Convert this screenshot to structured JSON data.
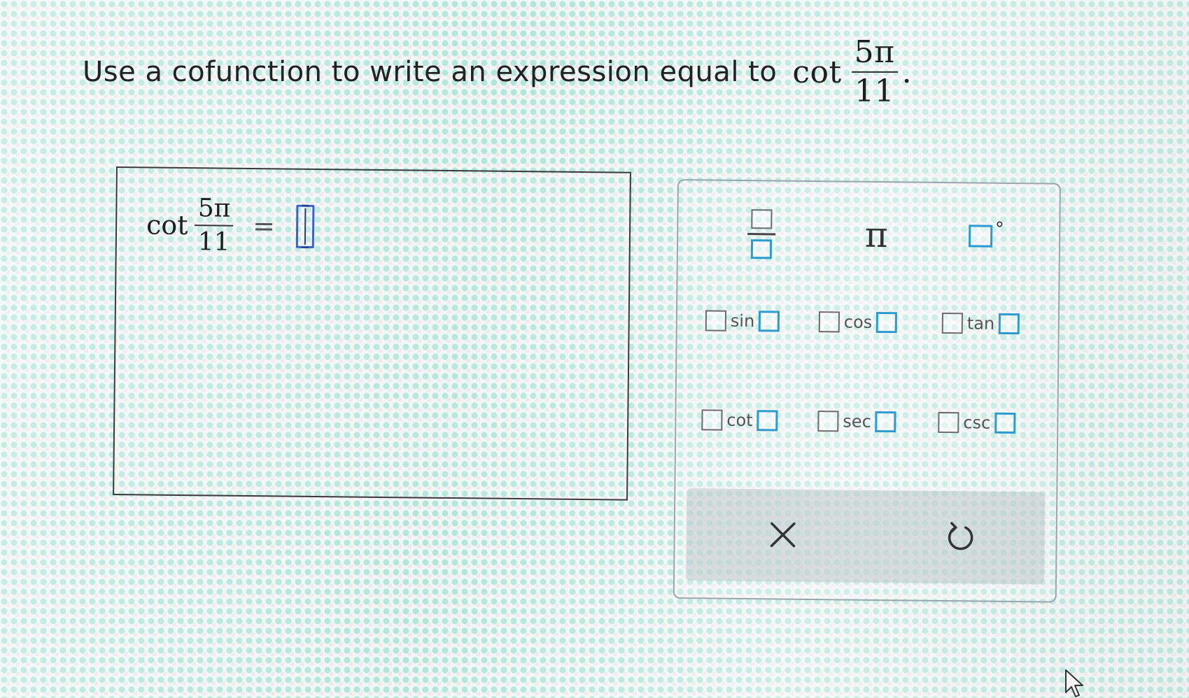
{
  "question": {
    "text": "Use a cofunction to write an expression equal to",
    "func": "cot",
    "numerator": "5π",
    "denominator": "11",
    "period": "."
  },
  "answer": {
    "func": "cot",
    "numerator": "5π",
    "denominator": "11",
    "equals": "="
  },
  "palette": {
    "pi_label": "π",
    "degree_symbol": "°",
    "trig_functions": [
      "sin",
      "cos",
      "tan",
      "cot",
      "sec",
      "csc"
    ],
    "actions": {
      "clear_icon": "close-icon",
      "undo_icon": "undo-icon"
    }
  },
  "colors": {
    "slot_blue": "#2d9bd0",
    "answer_cursor_blue": "#3c63c8",
    "box_gray": "#6c6c6c"
  }
}
